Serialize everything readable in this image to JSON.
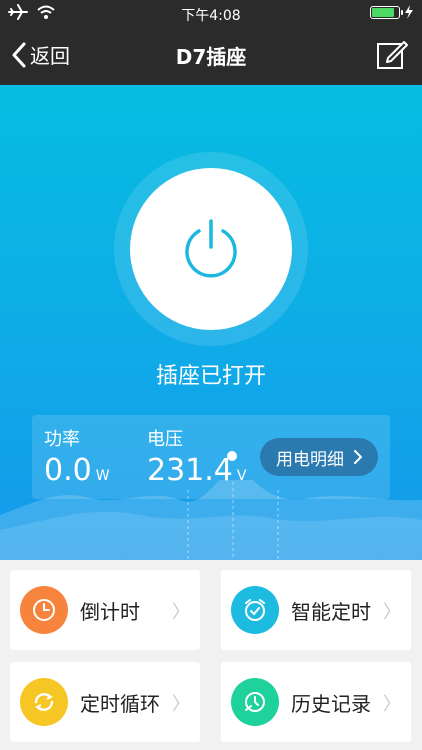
{
  "status": {
    "time": "下午4:08"
  },
  "nav": {
    "back_label": "返回",
    "title": "D7插座"
  },
  "device": {
    "state_text": "插座已打开"
  },
  "stats": {
    "power_label": "功率",
    "power_value": "0.0",
    "power_unit": "W",
    "voltage_label": "电压",
    "voltage_value": "231.4",
    "voltage_unit": "V",
    "detail_label": "用电明细"
  },
  "tiles": [
    {
      "label": "倒计时",
      "icon": "clock-icon",
      "color": "#f7843c"
    },
    {
      "label": "智能定时",
      "icon": "alarm-icon",
      "color": "#1dbbe0"
    },
    {
      "label": "定时循环",
      "icon": "refresh-icon",
      "color": "#f6c624"
    },
    {
      "label": "历史记录",
      "icon": "history-icon",
      "color": "#1fd19a"
    }
  ],
  "colors": {
    "accent": "#05bde0",
    "battery": "#4cd964"
  }
}
